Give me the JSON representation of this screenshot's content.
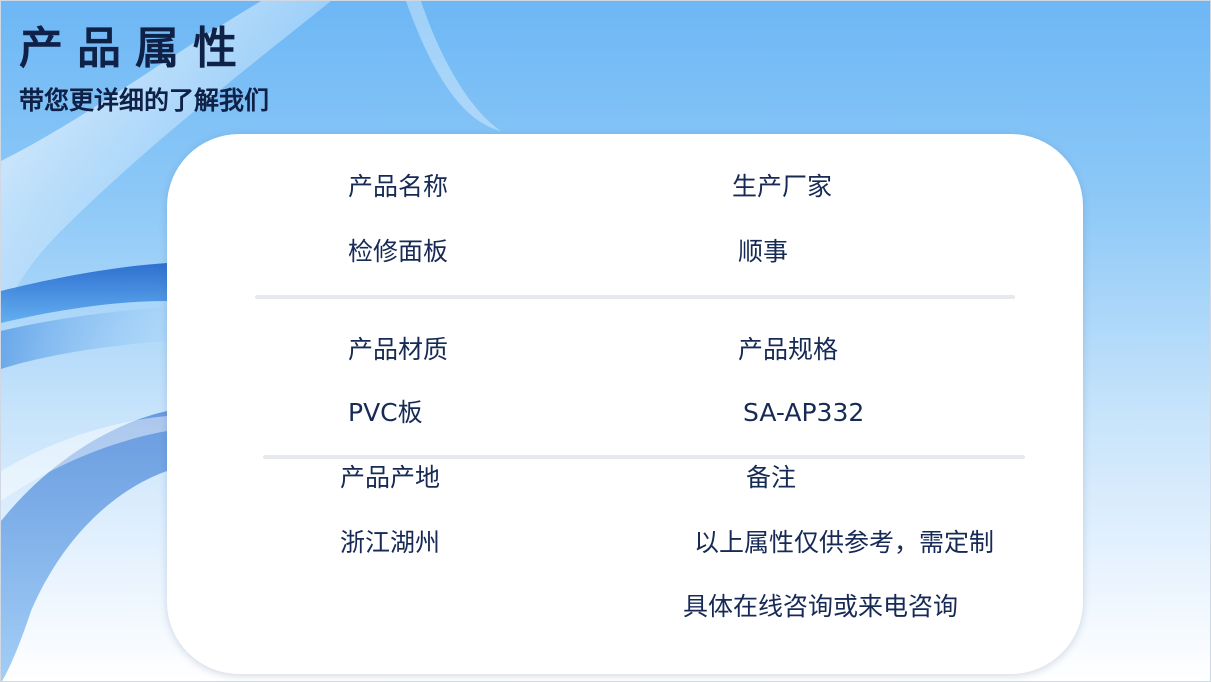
{
  "slide": {
    "title": "产品属性",
    "subtitle": "带您更详细的了解我们"
  },
  "properties": {
    "name": {
      "label": "产品名称",
      "value": "检修面板"
    },
    "maker": {
      "label": "生产厂家",
      "value": "顺事"
    },
    "material": {
      "label": "产品材质",
      "value": "PVC板"
    },
    "spec": {
      "label": "产品规格",
      "value": "SA-AP332"
    },
    "origin": {
      "label": "产品产地",
      "value": "浙江湖州"
    },
    "remark": {
      "label": "备注",
      "value_line1": "以上属性仅供参考，需定制",
      "value_line2": "具体在线咨询或来电咨询"
    }
  },
  "colors": {
    "title_text": "#0f2147",
    "body_text": "#162a55",
    "background_top": "#6db7f5",
    "wave_blue": "#1f6fd6"
  }
}
